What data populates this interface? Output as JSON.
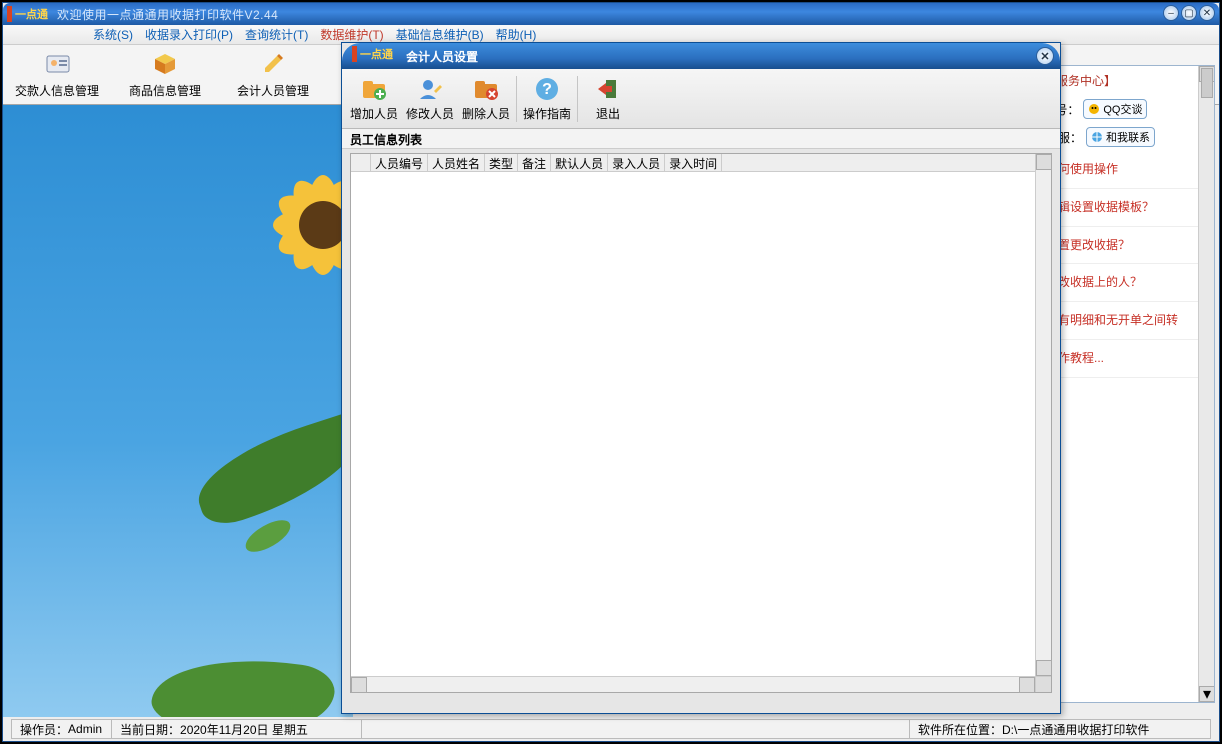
{
  "outer": {
    "logo": "一点通",
    "title": "欢迎使用一点通通用收据打印软件V2.44"
  },
  "menu": {
    "system": "系统(S)",
    "receiptPrint": "收据录入打印(P)",
    "queryStat": "查询统计(T)",
    "dataMaint": "数据维护(T)",
    "baseInfo": "基础信息维护(B)",
    "help": "帮助(H)"
  },
  "toolbar": {
    "payerInfo": "交款人信息管理",
    "productInfo": "商品信息管理",
    "accountant": "会计人员管理"
  },
  "dialog": {
    "logo": "一点通",
    "title": "会计人员设置",
    "btnAdd": "增加人员",
    "btnEdit": "修改人员",
    "btnDel": "删除人员",
    "btnGuide": "操作指南",
    "btnExit": "退出",
    "section": "员工信息列表",
    "columns": [
      "人员编号",
      "人员姓名",
      "类型",
      "备注",
      "默认人员",
      "录入人员",
      "录入时间"
    ]
  },
  "side": {
    "header": "线服务中心】",
    "qqLabel": "Q号：",
    "qqBadge": "QQ交谈",
    "kfLabel": "客服：",
    "kfBadge": "和我联系",
    "links": [
      "如何使用操作",
      "编辑设置收据模板？",
      "设置更改收据？",
      "更改收据上的人？",
      "在有明细和无开单之间转",
      "操作教程..."
    ]
  },
  "status": {
    "operLabel": "操作员：",
    "operVal": "Admin",
    "dateLabel": "当前日期：",
    "dateVal": "2020年11月20日 星期五",
    "locLabel": "软件所在位置：",
    "locVal": "D:\\一点通通用收据打印软件"
  }
}
